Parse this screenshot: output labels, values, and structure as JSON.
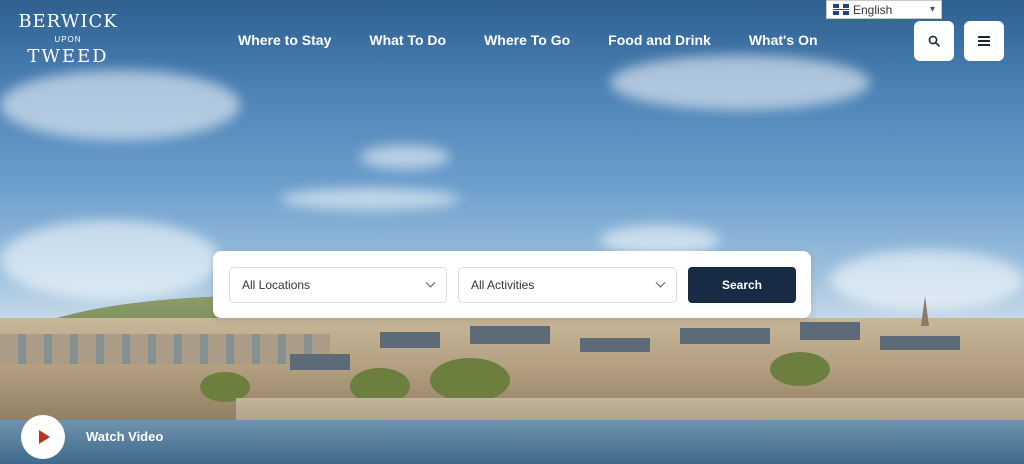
{
  "brand": {
    "line1": "BERWICK",
    "line2": "UPON",
    "line3": "TWEED"
  },
  "nav": {
    "items": [
      "Where to Stay",
      "What To Do",
      "Where To Go",
      "Food and Drink",
      "What's On"
    ]
  },
  "language": {
    "selected": "English",
    "icon": "uk-flag-icon"
  },
  "header_buttons": {
    "search_icon": "search-icon",
    "menu_icon": "menu-icon"
  },
  "search": {
    "location": "All Locations",
    "activity": "All Activities",
    "button": "Search"
  },
  "video": {
    "label": "Watch Video",
    "icon": "play-icon"
  },
  "colors": {
    "search_button": "#172b45",
    "play_icon": "#b8361f"
  }
}
